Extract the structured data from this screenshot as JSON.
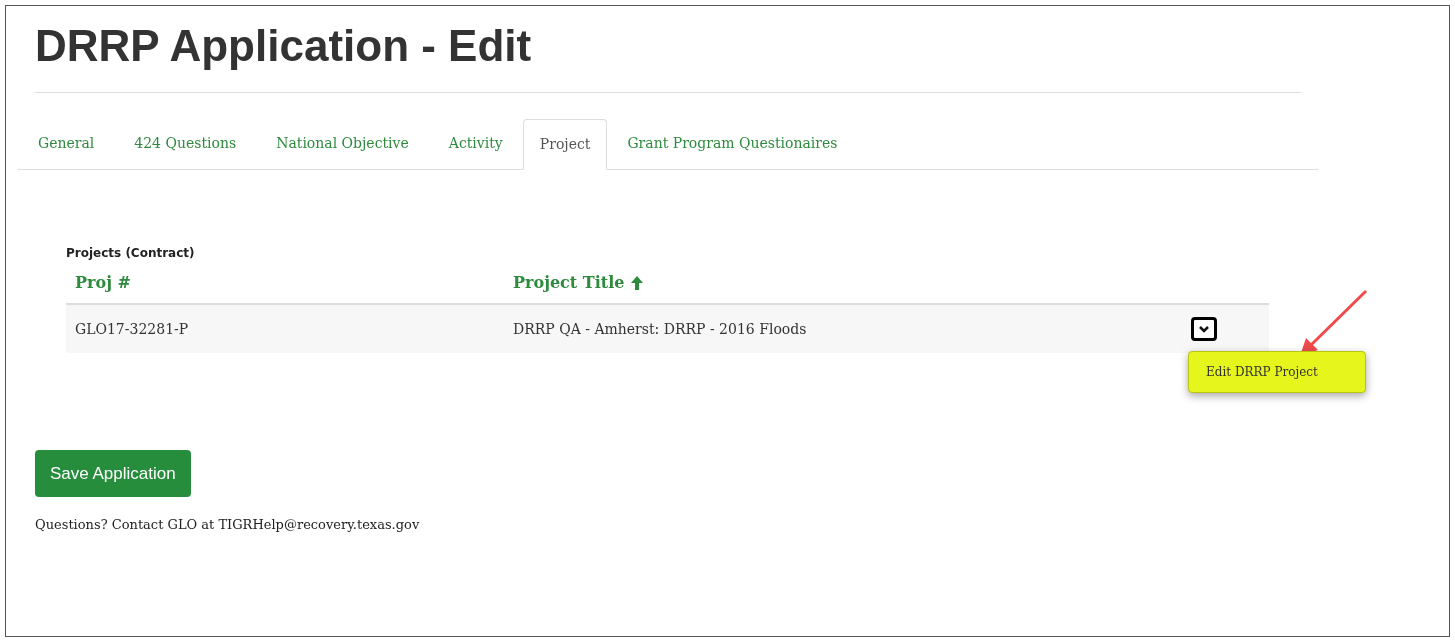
{
  "page": {
    "title": "DRRP Application - Edit"
  },
  "tabs": [
    {
      "label": "General",
      "selected": false
    },
    {
      "label": "424 Questions",
      "selected": false
    },
    {
      "label": "National Objective",
      "selected": false
    },
    {
      "label": "Activity",
      "selected": false
    },
    {
      "label": "Project",
      "selected": true
    },
    {
      "label": "Grant Program Questionaires",
      "selected": false
    }
  ],
  "projects": {
    "caption": "Projects (Contract)",
    "columns": [
      {
        "label": "Proj #",
        "sorted": false
      },
      {
        "label": "Project Title",
        "sorted": true
      }
    ],
    "rows": [
      {
        "cells": [
          "GLO17-32281-P",
          "DRRP QA - Amherst: DRRP - 2016 Floods"
        ],
        "menu_open": true,
        "menu_items": [
          "Edit DRRP Project"
        ]
      }
    ]
  },
  "save_button": "Save Application",
  "contact": "Questions? Contact GLO at TIGRHelp@recovery.texas.gov"
}
